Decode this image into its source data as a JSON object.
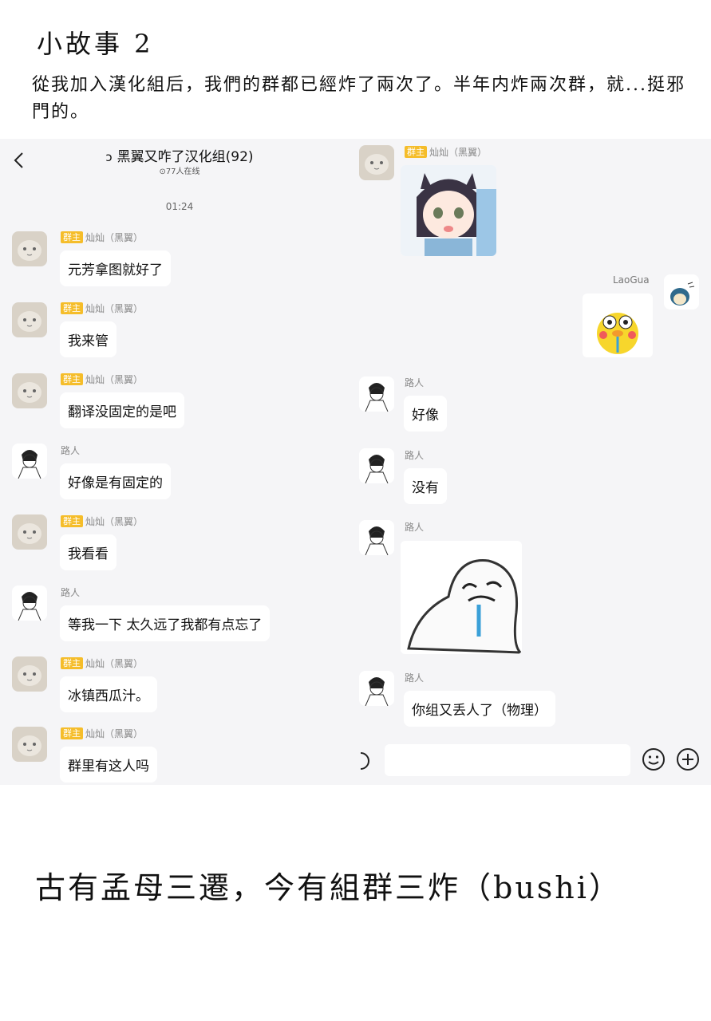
{
  "story": {
    "title": "小故事 2",
    "text": "從我加入漢化組后，我們的群都已經炸了兩次了。半年内炸兩次群，就...挺邪門的。",
    "bottom": "古有孟母三遷，今有組群三炸（bushi）"
  },
  "chat": {
    "title_icon": "ↄ",
    "title": "黑翼又咋了汉化组(92)",
    "online": "⊙77人在线",
    "timestamp": "01:24"
  },
  "labels": {
    "owner_badge": "群主",
    "owner_name": "灿灿（黑翼）",
    "passerby": "路人",
    "laogua": "LaoGua"
  },
  "left_messages": [
    {
      "sender": "owner",
      "text": "元芳拿图就好了"
    },
    {
      "sender": "owner",
      "text": "我来管"
    },
    {
      "sender": "owner",
      "text": "翻译没固定的是吧"
    },
    {
      "sender": "passerby",
      "text": "好像是有固定的"
    },
    {
      "sender": "owner",
      "text": "我看看"
    },
    {
      "sender": "passerby",
      "text": "等我一下 太久远了我都有点忘了"
    },
    {
      "sender": "owner",
      "text": "冰镇西瓜汁。"
    },
    {
      "sender": "owner",
      "text": "群里有这人吗"
    }
  ],
  "right_messages": [
    {
      "text": "好像"
    },
    {
      "text": "没有"
    },
    {
      "text": "你组又丢人了（物理）"
    }
  ],
  "colors": {
    "badge": "#f5bd2a",
    "chat_bg": "#f5f5f7",
    "bubble": "#ffffff"
  },
  "icons": [
    "back-arrow-icon",
    "emoji-icon",
    "plus-icon",
    "voice-icon"
  ]
}
